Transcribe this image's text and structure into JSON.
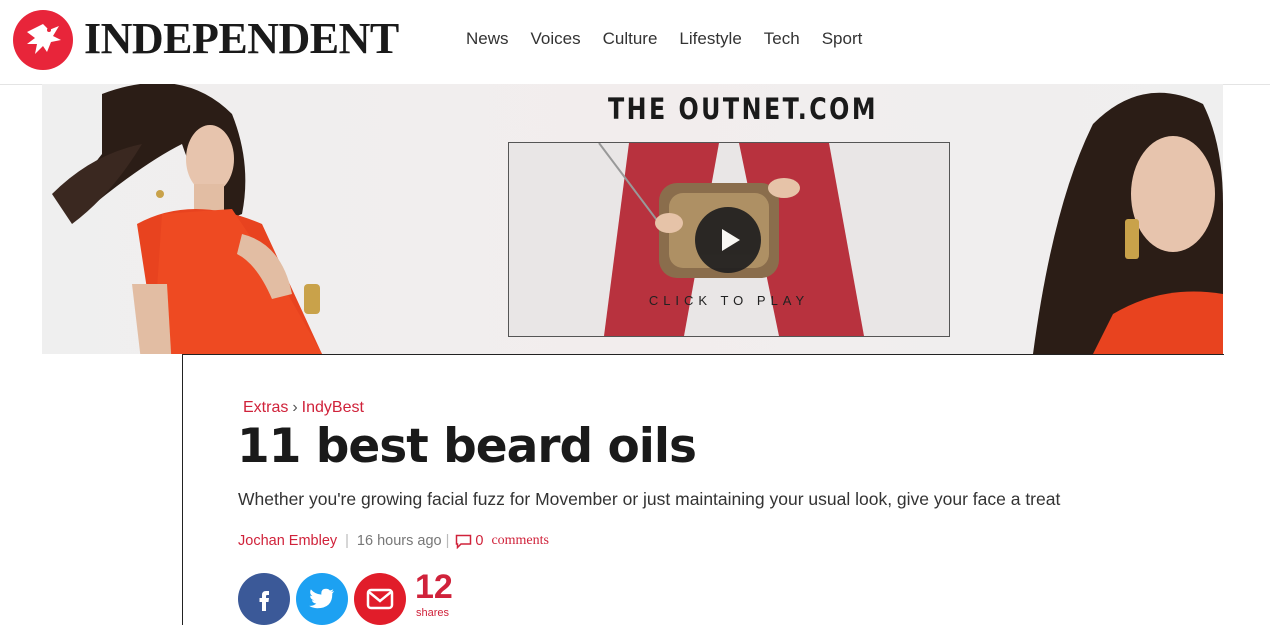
{
  "header": {
    "wordmark": "INDEPENDENT",
    "nav": [
      "News",
      "Voices",
      "Culture",
      "Lifestyle",
      "Tech",
      "Sport"
    ],
    "logo_icon": "eagle-logo-icon",
    "brand_color": "#e8253a"
  },
  "ad": {
    "brand": "THE OUTNET.COM",
    "cta": "CLICK TO PLAY",
    "play_icon": "play-icon"
  },
  "article": {
    "breadcrumb": [
      "Extras",
      "IndyBest"
    ],
    "title": "11 best beard oils",
    "standfirst": "Whether you're growing facial fuzz for Movember or just maintaining your usual look, give your face a treat",
    "author": "Jochan Embley",
    "time": "16 hours  ago",
    "comment_count": "0",
    "comment_label": "comments",
    "share_count": "12",
    "share_label": "shares",
    "share_icons": [
      "facebook-icon",
      "twitter-icon",
      "email-icon"
    ],
    "accent_color": "#d0223a"
  }
}
